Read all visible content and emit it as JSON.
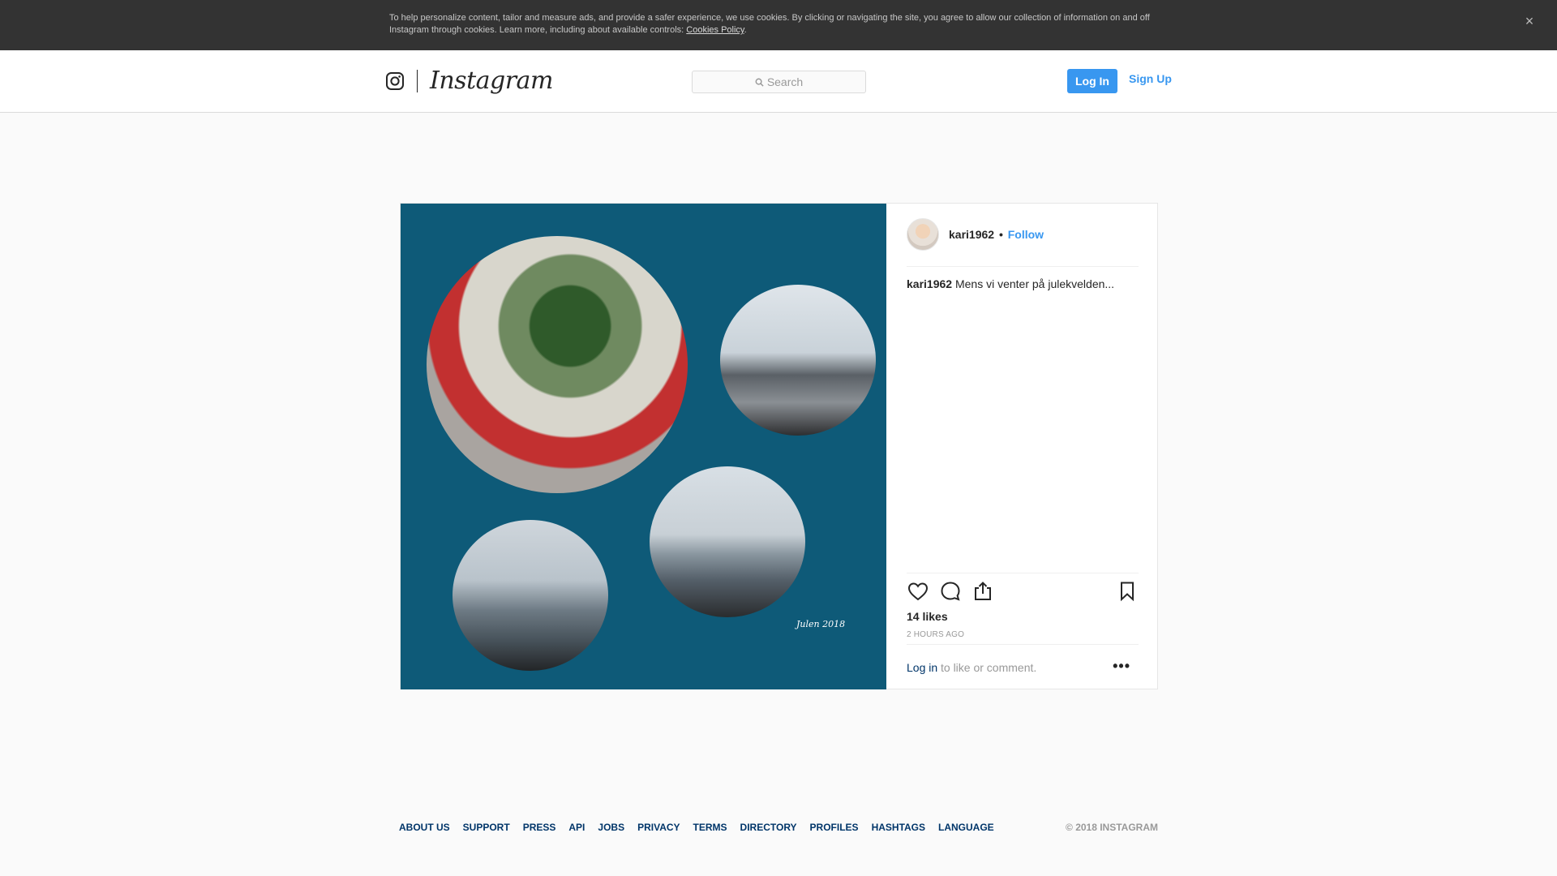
{
  "cookie": {
    "text": "To help personalize content, tailor and measure ads, and provide a safer experience, we use cookies. By clicking or navigating the site, you agree to allow our collection of information on and off Instagram through cookies. Learn more, including about available controls: ",
    "link": "Cookies Policy",
    "after": ".",
    "close": "×"
  },
  "header": {
    "brand": "Instagram",
    "search_placeholder": "Search",
    "login": "Log In",
    "signup": "Sign Up"
  },
  "post": {
    "photo_caption": "Julen 2018",
    "username": "kari1962",
    "separator": "•",
    "follow": "Follow",
    "caption_user": "kari1962",
    "caption_text": "Mens vi venter på julekvelden...",
    "likes": "14 likes",
    "time": "2 HOURS AGO",
    "login_link": "Log in",
    "login_rest": "to like or comment.",
    "more": "•••"
  },
  "footer": {
    "links": [
      "ABOUT US",
      "SUPPORT",
      "PRESS",
      "API",
      "JOBS",
      "PRIVACY",
      "TERMS",
      "DIRECTORY",
      "PROFILES",
      "HASHTAGS",
      "LANGUAGE"
    ],
    "copyright": "© 2018 INSTAGRAM"
  },
  "colors": {
    "accent": "#3897f0",
    "link_dark": "#003569",
    "photo_bg": "#0e5a78"
  }
}
